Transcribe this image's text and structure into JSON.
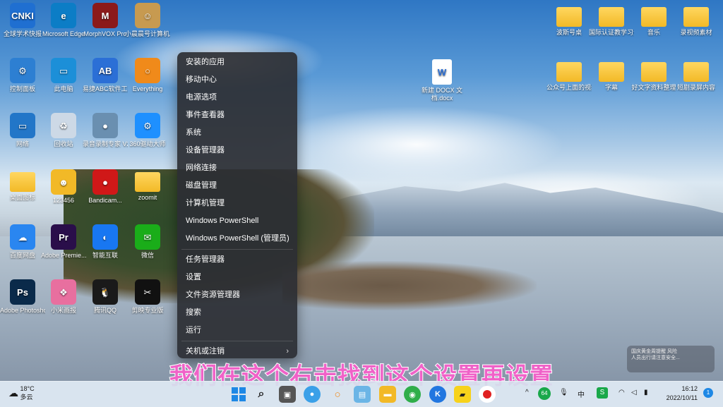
{
  "desktop_icons": [
    {
      "label": "全球学术快报",
      "color": "#1f6fd1",
      "text": "CNKI"
    },
    {
      "label": "Microsoft Edge",
      "color": "#0c7dc6",
      "text": "e"
    },
    {
      "label": "MorphVOX Pro",
      "color": "#8b1a1a",
      "text": "M"
    },
    {
      "label": "小晨晨号计算机二级WPS...",
      "color": "#c79a50",
      "text": "☺"
    },
    {
      "label": "控制面板",
      "color": "#2d7fd2",
      "text": "⚙"
    },
    {
      "label": "此电脑",
      "color": "#1c8fd8",
      "text": "▭"
    },
    {
      "label": "易捷ABC软件工具箱 6.16...",
      "color": "#2b6fd6",
      "text": "AB"
    },
    {
      "label": "Everything",
      "color": "#f08a1a",
      "text": "○"
    },
    {
      "label": "网络",
      "color": "#2276c8",
      "text": "▭"
    },
    {
      "label": "回收站",
      "color": "#cdd9e6",
      "text": "♻"
    },
    {
      "label": "录音录制专家 V2021",
      "color": "#6a8fb0",
      "text": "●"
    },
    {
      "label": "360驱动大师",
      "color": "#1e90ff",
      "text": "⚙"
    },
    {
      "label": "桌面图标",
      "color": "#f2b927",
      "text": ""
    },
    {
      "label": "123456",
      "color": "#f2b927",
      "text": "☻"
    },
    {
      "label": "Bandicam...",
      "color": "#d01818",
      "text": "●"
    },
    {
      "label": "zoomit",
      "color": "#f2b927",
      "text": ""
    },
    {
      "label": "百度网盘",
      "color": "#2a86f0",
      "text": "☁"
    },
    {
      "label": "Adobe Premie...",
      "color": "#2a0e4a",
      "text": "Pr"
    },
    {
      "label": "智能互联",
      "color": "#1877f2",
      "text": "◐"
    },
    {
      "label": "微信",
      "color": "#1aad19",
      "text": "✉"
    },
    {
      "label": "Adobe Photosho...",
      "color": "#0a2a4a",
      "text": "Ps"
    },
    {
      "label": "小米画报",
      "color": "#e86f9f",
      "text": "❖"
    },
    {
      "label": "腾讯QQ",
      "color": "#1a1a1a",
      "text": "🐧"
    },
    {
      "label": "剪映专业版",
      "color": "#111111",
      "text": "✂"
    }
  ],
  "right_icons": [
    {
      "label": "波斯号桌",
      "color": "#f2b927"
    },
    {
      "label": "国际认证教学习资料",
      "color": "#f2b927"
    },
    {
      "label": "音乐",
      "color": "#f2b927"
    },
    {
      "label": "录视频素材",
      "color": "#f2b927"
    },
    {
      "label": "公众号上面的视频素材从V...",
      "color": "#f2b927"
    },
    {
      "label": "字幕",
      "color": "#f2b927"
    },
    {
      "label": "好文字资料整理",
      "color": "#f2b927"
    },
    {
      "label": "短剧录屏内容",
      "color": "#f2b927"
    }
  ],
  "doc_icon": {
    "label": "新建 DOCX 文档.docx",
    "text": "W"
  },
  "context_menu": {
    "items": [
      "安装的应用",
      "移动中心",
      "电源选项",
      "事件查看器",
      "系统",
      "设备管理器",
      "网络连接",
      "磁盘管理",
      "计算机管理",
      "Windows PowerShell",
      "Windows PowerShell (管理员)",
      "任务管理器",
      "设置",
      "文件资源管理器",
      "搜索",
      "运行",
      "关机或注销"
    ],
    "submenu_chevron": "›"
  },
  "subtitle": "我们在这个右击找到这个设置再设置",
  "notification": {
    "title": "国庆黄金周提醒 风险",
    "body": "人员出行请注意安全..."
  },
  "taskbar": {
    "weather_temp": "18°C",
    "weather_desc": "多云",
    "tray_badge": "64",
    "ime": "中",
    "time": "16:12",
    "date": "2022/10/11",
    "notify_count": "1"
  },
  "colors": {
    "subtitle": "#f062c8",
    "menu_bg": "#2c2e34",
    "taskbar_bg": "#d6e2ee"
  }
}
